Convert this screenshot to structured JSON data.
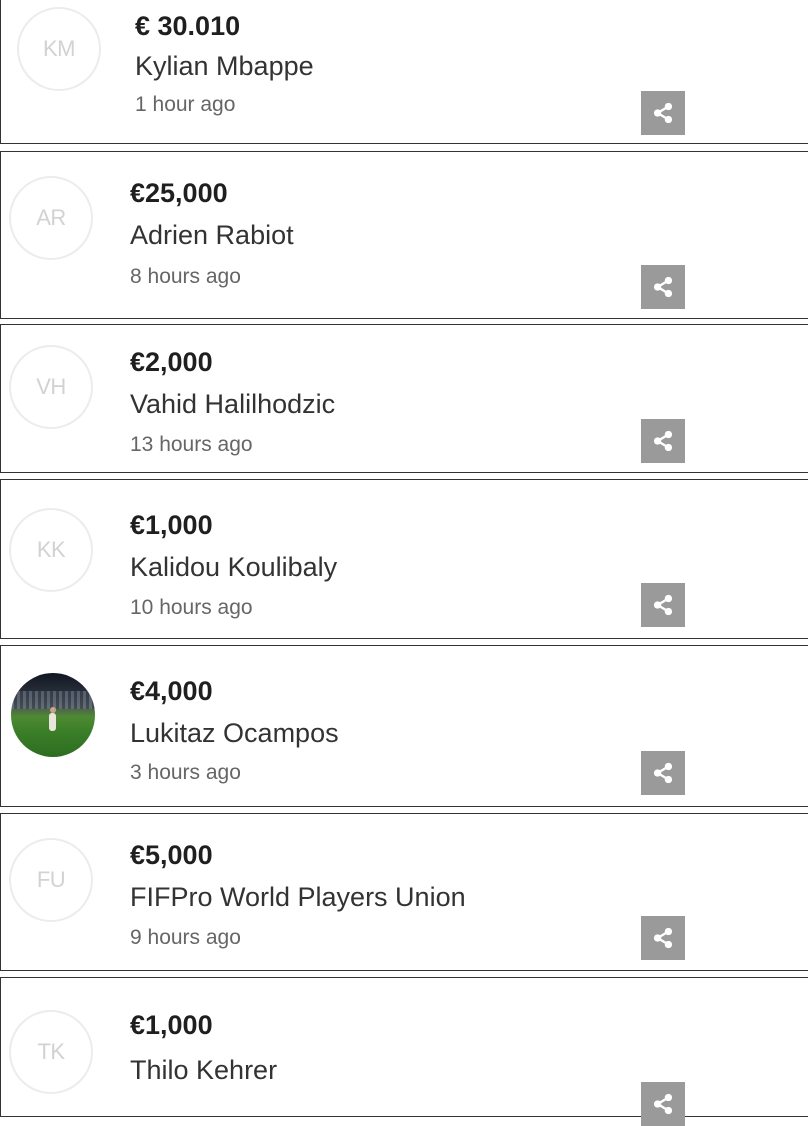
{
  "donations": [
    {
      "initials": "KM",
      "amount": "€ 30.010",
      "name": "Kylian Mbappe",
      "time": "1 hour ago"
    },
    {
      "initials": "AR",
      "amount": "€25,000",
      "name": "Adrien Rabiot",
      "time": "8 hours ago"
    },
    {
      "initials": "VH",
      "amount": "€2,000",
      "name": "Vahid Halilhodzic",
      "time": "13 hours ago"
    },
    {
      "initials": "KK",
      "amount": "€1,000",
      "name": "Kalidou Koulibaly",
      "time": "10 hours ago"
    },
    {
      "initials": "",
      "amount": "€4,000",
      "name": "Lukitaz Ocampos",
      "time": "3 hours ago"
    },
    {
      "initials": "FU",
      "amount": "€5,000",
      "name": "FIFPro World Players Union",
      "time": "9 hours ago"
    },
    {
      "initials": "TK",
      "amount": "€1,000",
      "name": "Thilo Kehrer",
      "time": ""
    }
  ],
  "icons": {
    "share": "share-icon"
  },
  "colors": {
    "share_button_bg": "#9a9a9a",
    "avatar_border": "#ececec",
    "avatar_initials": "#d2d2d2",
    "card_border": "#333333"
  }
}
